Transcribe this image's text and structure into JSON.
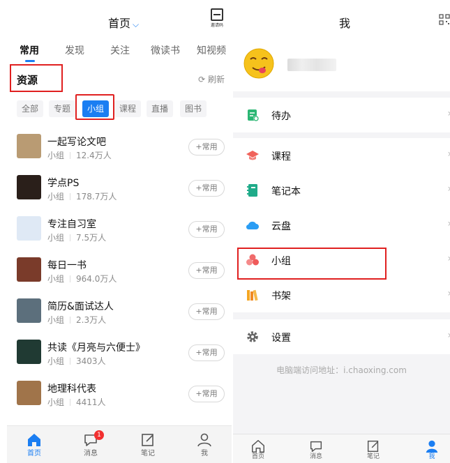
{
  "left": {
    "header": {
      "title": "首页",
      "invite_label": "邀请码"
    },
    "tabs": [
      "常用",
      "发现",
      "关注",
      "微读书",
      "知视频"
    ],
    "section_title": "资源",
    "refresh_label": "刷新",
    "filters": [
      "全部",
      "专题",
      "小组",
      "课程",
      "直播",
      "图书"
    ],
    "active_filter": "小组",
    "add_label": "+常用",
    "items": [
      {
        "name": "一起写论文吧",
        "type": "小组",
        "count": "12.4万人",
        "thumb_color": "#b99b73"
      },
      {
        "name": "学点PS",
        "type": "小组",
        "count": "178.7万人",
        "thumb_color": "#2a1f1a"
      },
      {
        "name": "专注自习室",
        "type": "小组",
        "count": "7.5万人",
        "thumb_color": "#dfe9f5"
      },
      {
        "name": "每日一书",
        "type": "小组",
        "count": "964.0万人",
        "thumb_color": "#7a3b2a"
      },
      {
        "name": "简历&面试达人",
        "type": "小组",
        "count": "2.3万人",
        "thumb_color": "#5c6f7c"
      },
      {
        "name": "共读《月亮与六便士》",
        "type": "小组",
        "count": "3403人",
        "thumb_color": "#203a33"
      },
      {
        "name": "地理科代表",
        "type": "小组",
        "count": "4411人",
        "thumb_color": "#a0744a"
      }
    ],
    "bottom_nav": [
      {
        "label": "首页",
        "icon": "home-icon",
        "active": true
      },
      {
        "label": "消息",
        "icon": "chat-icon",
        "badge": "1"
      },
      {
        "label": "笔记",
        "icon": "note-icon"
      },
      {
        "label": "我",
        "icon": "person-icon"
      }
    ]
  },
  "right": {
    "header": {
      "title": "我"
    },
    "menu_groups": [
      [
        {
          "label": "待办",
          "icon": "todo-icon",
          "color": "#2bb673"
        }
      ],
      [
        {
          "label": "课程",
          "icon": "course-icon",
          "color": "#f0625a"
        },
        {
          "label": "笔记本",
          "icon": "notebook-icon",
          "color": "#1fab89"
        },
        {
          "label": "云盘",
          "icon": "cloud-icon",
          "color": "#2a9df4"
        },
        {
          "label": "小组",
          "icon": "group-icon",
          "color": "#f06b6b"
        },
        {
          "label": "书架",
          "icon": "bookshelf-icon",
          "color": "#f5a623"
        }
      ],
      [
        {
          "label": "设置",
          "icon": "gear-icon",
          "color": "#666666"
        }
      ]
    ],
    "footer_text": "电脑端访问地址：i.chaoxing.com",
    "bottom_nav": [
      {
        "label": "首页",
        "icon": "home-icon"
      },
      {
        "label": "消息",
        "icon": "chat-icon"
      },
      {
        "label": "笔记",
        "icon": "note-icon"
      },
      {
        "label": "我",
        "icon": "person-icon",
        "active": true
      }
    ]
  },
  "colors": {
    "accent": "#1b7ef2",
    "highlight": "#e02020",
    "badge": "#f23030"
  }
}
